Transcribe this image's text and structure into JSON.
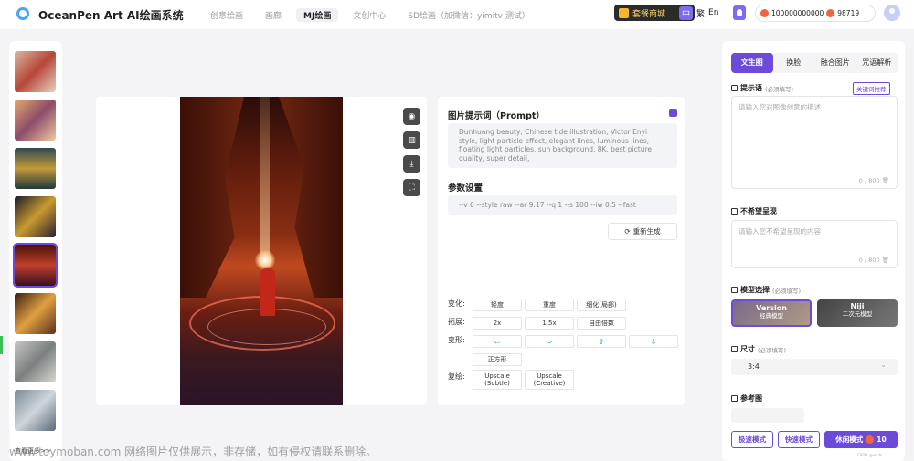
{
  "header": {
    "app_title": "OceanPen Art AI绘画系统",
    "nav": [
      "创意绘画",
      "画廊",
      "MJ绘画",
      "文创中心",
      "SD绘画（加微信：yimitv 测试）"
    ],
    "active_nav": "MJ绘画",
    "shop_label": "套餐商城",
    "lang": [
      "中",
      "繁",
      "En"
    ],
    "balance_1": "100000000000",
    "balance_2": "98719"
  },
  "gallery": {
    "more_label": "查看更多>>"
  },
  "viewer": {
    "tool_icons": [
      "eye-icon",
      "trash-icon",
      "download-icon",
      "fullscreen-icon"
    ]
  },
  "info": {
    "prompt_title": "图片提示词（Prompt）",
    "prompt_text": "Dunhuang beauty, Chinese tide illustration, Victor Enyi style, light particle effect, elegant lines, luminous lines, floating light particles, sun background, 8K, best picture quality, super detail,",
    "params_title": "参数设置",
    "params_text": "--v 6 --style raw --ar 9:17 --q 1 --s 100 --iw 0.5 --fast",
    "regen_label": "重新生成",
    "vary_label": "变化:",
    "vary_buttons": [
      "轻度",
      "重度",
      "细化(局部)"
    ],
    "zoom_label": "拓展:",
    "zoom_buttons": [
      "2x",
      "1.5x",
      "自由倍数"
    ],
    "pan_label": "变形:",
    "pan_arrows": [
      "⇦",
      "⇨",
      "⇧",
      "⇩"
    ],
    "square_label": "正方形",
    "upscale_label": "复绘:",
    "upscale_1a": "Upscale",
    "upscale_1b": "(Subtle)",
    "upscale_2a": "Upscale",
    "upscale_2b": "(Creative)"
  },
  "panel": {
    "tabs": [
      "文生图",
      "换脸",
      "融合图片",
      "咒语解析"
    ],
    "prompt_label": "提示语",
    "prompt_req": "(必须填写)",
    "keyword_btn": "关键词推荐",
    "prompt_placeholder": "请输入您对图像创意的描述",
    "counter1": "0 / 800",
    "negative_label": "不希望呈现",
    "negative_placeholder": "请输入您不希望呈现的内容",
    "counter2": "0 / 800",
    "model_label": "模型选择",
    "model_req": "(必须填写)",
    "model1_name": "Version",
    "model1_sub": "经典模型",
    "model2_name": "Niji",
    "model2_sub": "二次元模型",
    "size_label": "尺寸",
    "size_req": "(必须填写)",
    "size_value": "3:4",
    "ref_label": "参考图",
    "mode_fast": "极速模式",
    "mode_quick": "快速模式",
    "mode_relax": "休闲模式",
    "mode_relax_count": "10"
  },
  "watermark": "www.toymoban.com 网络图片仅供展示，非存储，如有侵权请联系删除。",
  "credit": "CSDN @ovchi"
}
